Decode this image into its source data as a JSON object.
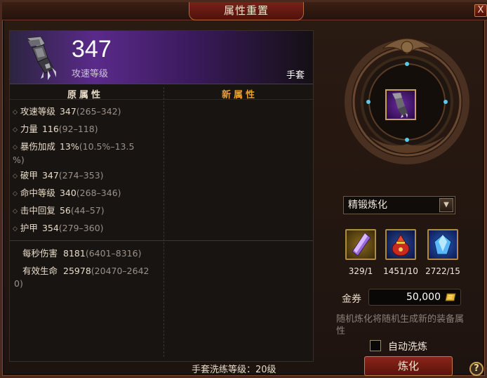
{
  "window": {
    "title": "属性重置",
    "close_glyph": "X"
  },
  "item": {
    "value": "347",
    "stat_name": "攻速等级",
    "type": "手套"
  },
  "columns": {
    "original": "原属性",
    "new": "新属性"
  },
  "stats": [
    {
      "name": "攻速等级",
      "value": "347",
      "range": "(265–342)"
    },
    {
      "name": "力量",
      "value": "116",
      "range": "(92–118)"
    },
    {
      "name": "暴伤加成",
      "value": "13%",
      "range": "(10.5%–13.5",
      "range_cont": "%)"
    },
    {
      "name": "破甲",
      "value": "347",
      "range": "(274–353)"
    },
    {
      "name": "命中等级",
      "value": "340",
      "range": "(268–346)"
    },
    {
      "name": "击中回复",
      "value": "56",
      "range": "(44–57)"
    },
    {
      "name": "护甲",
      "value": "354",
      "range": "(279–360)"
    }
  ],
  "summary": [
    {
      "name": "每秒伤害",
      "value": "8181",
      "range": "(6401–8316)"
    },
    {
      "name": "有效生命",
      "value": "25978",
      "range": "(20470–2642",
      "range_cont": "0)"
    }
  ],
  "footer": {
    "level_text": "手套洗练等级：20级"
  },
  "refine": {
    "mode": "精锻炼化",
    "arrow_glyph": "▼",
    "materials": [
      {
        "icon": "purple-crystal-icon",
        "count": "329/1"
      },
      {
        "icon": "red-bag-icon",
        "count": "1451/10"
      },
      {
        "icon": "blue-gem-icon",
        "count": "2722/15"
      }
    ],
    "gold_label": "金券",
    "gold_value": "50,000",
    "hint": "随机炼化将随机生成新的装备属性",
    "auto_label": "自动洗炼",
    "button_label": "炼化",
    "help_glyph": "?"
  },
  "colors": {
    "accent_orange": "#e8a030",
    "button_red": "#8a2418",
    "header_purple": "#5a2a8a",
    "gold_border": "#b08a40"
  }
}
